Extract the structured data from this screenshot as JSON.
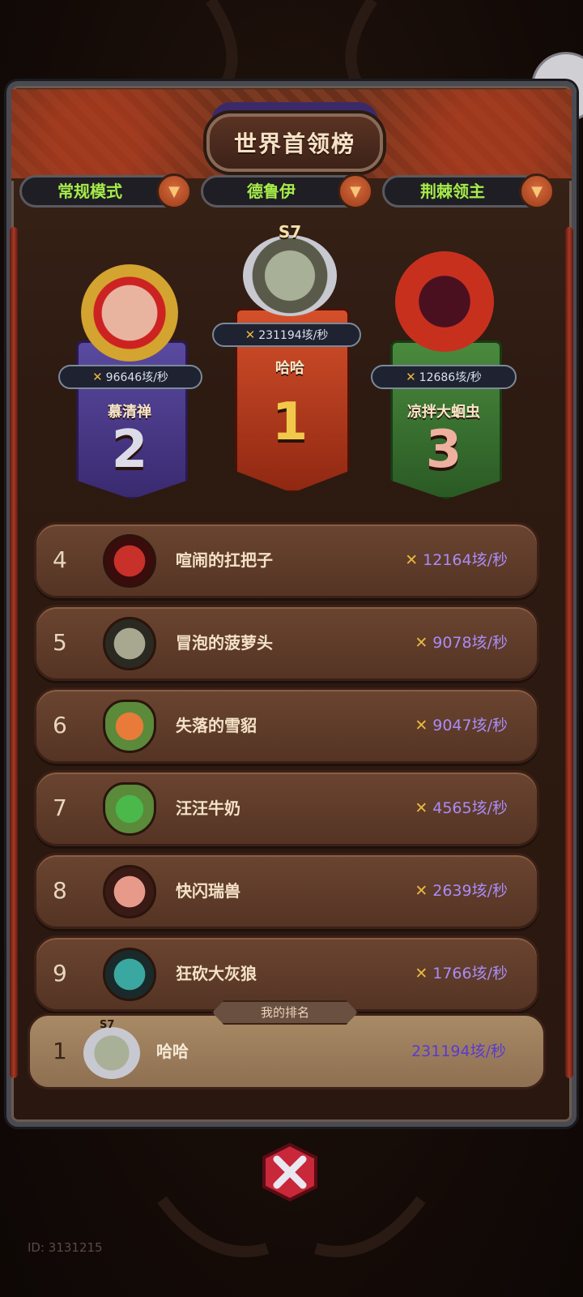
{
  "title": "世界首领榜",
  "filters": [
    {
      "label": "常规模式"
    },
    {
      "label": "德鲁伊"
    },
    {
      "label": "荆棘领主"
    }
  ],
  "podium": [
    {
      "rank": "2",
      "name": "慕清禅",
      "score": "96646垓/秒",
      "color": "#4a3a8a"
    },
    {
      "rank": "1",
      "name": "哈哈",
      "score": "231194垓/秒",
      "season": "S7",
      "color": "#b53a1e"
    },
    {
      "rank": "3",
      "name": "凉拌大蛔虫",
      "score": "12686垓/秒",
      "color": "#3a6a32"
    }
  ],
  "rows": [
    {
      "rank": "4",
      "name": "喧闹的扛把子",
      "score": "12164垓/秒"
    },
    {
      "rank": "5",
      "name": "冒泡的菠萝头",
      "score": "9078垓/秒"
    },
    {
      "rank": "6",
      "name": "失落的雪貂",
      "score": "9047垓/秒"
    },
    {
      "rank": "7",
      "name": "汪汪牛奶",
      "score": "4565垓/秒"
    },
    {
      "rank": "8",
      "name": "快闪瑞兽",
      "score": "2639垓/秒"
    },
    {
      "rank": "9",
      "name": "狂砍大灰狼",
      "score": "1766垓/秒"
    }
  ],
  "my_rank": {
    "tag": "我的排名",
    "rank": "1",
    "name": "哈哈",
    "score": "231194垓/秒",
    "season": "S7"
  },
  "footer": {
    "id": "ID: 3131215"
  },
  "icons": {
    "dropdown": "chevron-down-icon",
    "score": "crossed-swords-icon",
    "close": "close-icon"
  }
}
